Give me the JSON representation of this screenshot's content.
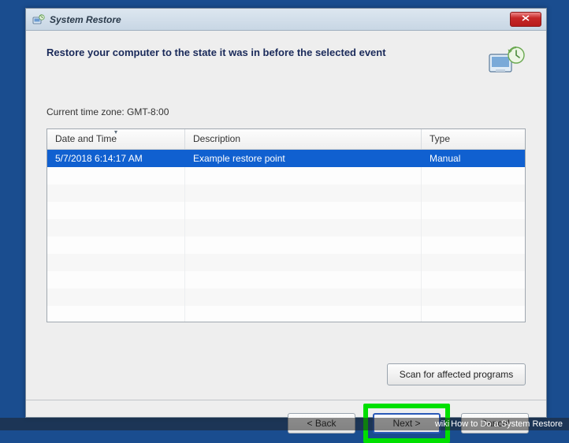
{
  "window": {
    "title": "System Restore"
  },
  "heading": "Restore your computer to the state it was in before the selected event",
  "timezone_label": "Current time zone: GMT-8:00",
  "table": {
    "columns": {
      "datetime": "Date and Time",
      "description": "Description",
      "type": "Type"
    },
    "rows": [
      {
        "datetime": "5/7/2018 6:14:17 AM",
        "description": "Example restore point",
        "type": "Manual"
      }
    ]
  },
  "buttons": {
    "scan": "Scan for affected programs",
    "back": "< Back",
    "next": "Next >",
    "cancel": "Cancel"
  },
  "caption": {
    "prefix": "wiki",
    "text": "How to Do a System Restore"
  }
}
